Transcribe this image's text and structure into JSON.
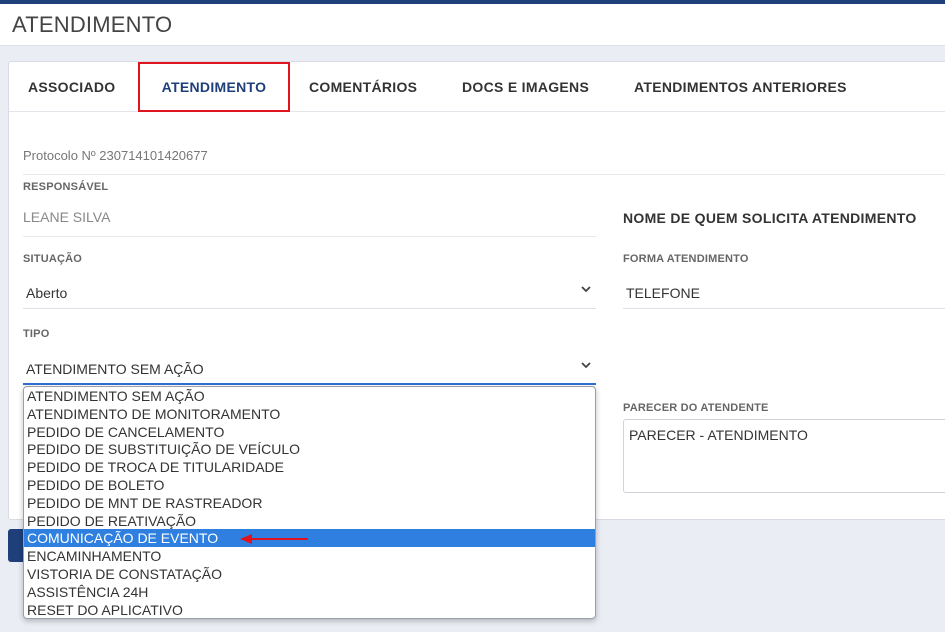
{
  "page": {
    "title": "ATENDIMENTO"
  },
  "tabs": [
    {
      "label": "ASSOCIADO",
      "active": false
    },
    {
      "label": "ATENDIMENTO",
      "active": true
    },
    {
      "label": "COMENTÁRIOS",
      "active": false
    },
    {
      "label": "DOCS E IMAGENS",
      "active": false
    },
    {
      "label": "ATENDIMENTOS ANTERIORES",
      "active": false
    }
  ],
  "form": {
    "protocol": "Protocolo Nº 230714101420677",
    "responsavel": {
      "label": "RESPONSÁVEL",
      "value": "LEANE SILVA"
    },
    "solicitante_heading": "NOME DE QUEM SOLICITA ATENDIMENTO",
    "situacao": {
      "label": "SITUAÇÃO",
      "value": "Aberto"
    },
    "forma": {
      "label": "FORMA ATENDIMENTO",
      "value": "TELEFONE"
    },
    "tipo": {
      "label": "TIPO",
      "value": "ATENDIMENTO SEM AÇÃO"
    },
    "parecer": {
      "label": "PARECER DO ATENDENTE",
      "value": "PARECER - ATENDIMENTO"
    }
  },
  "dropdown": {
    "options": [
      "ATENDIMENTO SEM AÇÃO",
      "ATENDIMENTO DE MONITORAMENTO",
      "PEDIDO DE CANCELAMENTO",
      "PEDIDO DE SUBSTITUIÇÃO DE VEÍCULO",
      "PEDIDO DE TROCA DE TITULARIDADE",
      "PEDIDO DE BOLETO",
      "PEDIDO DE MNT DE RASTREADOR",
      "PEDIDO DE REATIVAÇÃO",
      "COMUNICAÇÃO DE EVENTO",
      "ENCAMINHAMENTO",
      "VISTORIA DE CONSTATAÇÃO",
      "ASSISTÊNCIA 24H",
      "RESET DO APLICATIVO"
    ],
    "highlighted": "COMUNICAÇÃO DE EVENTO"
  },
  "colors": {
    "brand": "#1e3f7a",
    "highlight": "#2f7fe0",
    "annotation": "#e0141e"
  }
}
